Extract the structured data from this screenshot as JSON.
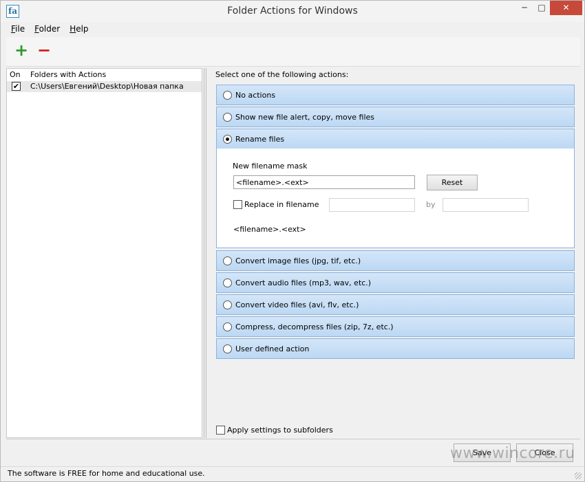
{
  "window": {
    "title": "Folder Actions for Windows",
    "app_icon_text": "fa",
    "minimize_glyph": "─",
    "maximize_glyph": "□",
    "close_glyph": "✕"
  },
  "menu": [
    "File",
    "Folder",
    "Help"
  ],
  "toolbar": {
    "add_glyph": "+",
    "remove_glyph": "−",
    "add_color": "#2e9a2e",
    "remove_color": "#d61c1c"
  },
  "folder_list": {
    "columns": [
      "On",
      "Folders with Actions"
    ],
    "rows": [
      {
        "checked": true,
        "check_glyph": "✔",
        "path": "C:\\Users\\Евгений\\Desktop\\Новая папка"
      }
    ]
  },
  "actions": {
    "prompt": "Select one of the following actions:",
    "items": [
      "No actions",
      "Show new file alert, copy, move files",
      "Rename files",
      "Convert image files (jpg, tif, etc.)",
      "Convert audio files (mp3, wav, etc.)",
      "Convert video files (avi, flv, etc.)",
      "Compress, decompress files (zip, 7z, etc.)",
      "User defined action"
    ],
    "selected": "Rename files"
  },
  "rename": {
    "mask_label": "New filename mask",
    "mask_value": "<filename>.<ext>",
    "reset_label": "Reset",
    "replace_label": "Replace in filename",
    "replace_checked": false,
    "replace_from": "",
    "by_label": "by",
    "replace_to": "",
    "preview": "<filename>.<ext>"
  },
  "apply_subfolders": {
    "label": "Apply settings to subfolders",
    "checked": false
  },
  "buttons": {
    "save": "Save",
    "close": "Close"
  },
  "status": "The software is FREE for home and educational use.",
  "watermark": "www.wincore.ru",
  "colors": {
    "action_bar": "#c6def6",
    "action_border": "#8db2dc",
    "close_button": "#c7493a"
  }
}
